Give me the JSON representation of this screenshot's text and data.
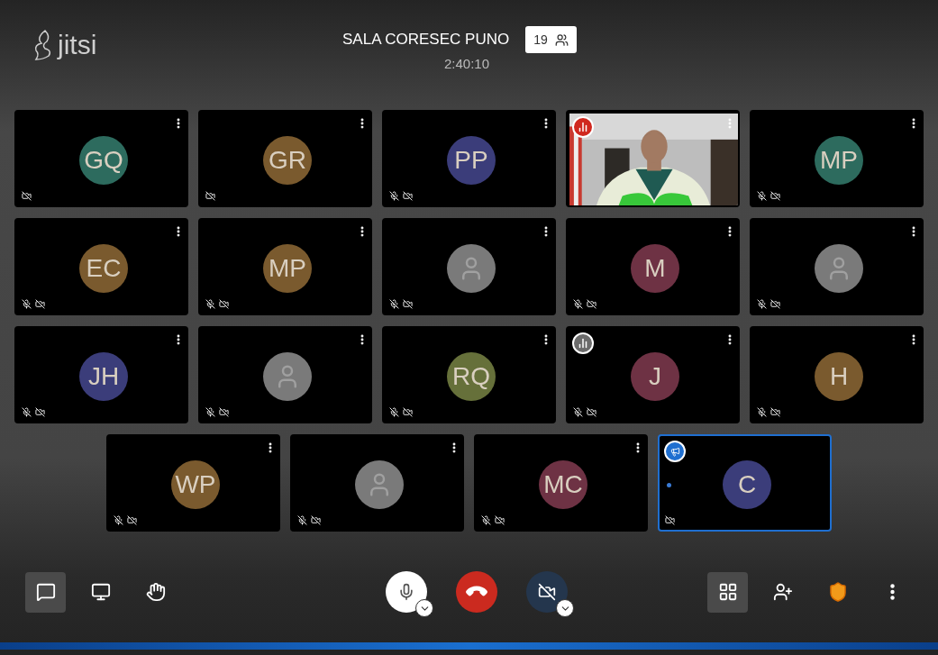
{
  "header": {
    "logo": "jitsi",
    "title": "SALA CORESEC PUNO",
    "participant_count": "19",
    "timer": "2:40:10"
  },
  "rows": [
    [
      {
        "kind": "avatar",
        "initials": "GQ",
        "color": "#2d6b5e",
        "mic_muted": false,
        "cam_muted": true,
        "menu": true,
        "selected": false
      },
      {
        "kind": "avatar",
        "initials": "GR",
        "color": "#7a5a2e",
        "mic_muted": false,
        "cam_muted": true,
        "menu": true,
        "selected": false
      },
      {
        "kind": "avatar",
        "initials": "PP",
        "color": "#3b3d7a",
        "mic_muted": true,
        "cam_muted": true,
        "menu": true,
        "selected": false
      },
      {
        "kind": "video",
        "badge": {
          "kind": "signal-poor"
        },
        "mic_muted": false,
        "cam_muted": false,
        "menu": true,
        "selected": false
      },
      {
        "kind": "avatar",
        "initials": "MP",
        "color": "#2d6b5e",
        "mic_muted": true,
        "cam_muted": true,
        "menu": true,
        "selected": false
      }
    ],
    [
      {
        "kind": "avatar",
        "initials": "EC",
        "color": "#7a5a2e",
        "mic_muted": true,
        "cam_muted": true,
        "menu": true,
        "selected": false
      },
      {
        "kind": "avatar",
        "initials": "MP",
        "color": "#7a5a2e",
        "mic_muted": true,
        "cam_muted": true,
        "menu": true,
        "selected": false
      },
      {
        "kind": "placeholder",
        "mic_muted": true,
        "cam_muted": true,
        "menu": true,
        "selected": false
      },
      {
        "kind": "avatar",
        "initials": "M",
        "color": "#6e3244",
        "mic_muted": true,
        "cam_muted": true,
        "menu": true,
        "selected": false
      },
      {
        "kind": "placeholder",
        "mic_muted": true,
        "cam_muted": true,
        "menu": true,
        "selected": false
      }
    ],
    [
      {
        "kind": "avatar",
        "initials": "JH",
        "color": "#3b3d7a",
        "mic_muted": true,
        "cam_muted": true,
        "menu": true,
        "selected": false
      },
      {
        "kind": "placeholder",
        "mic_muted": true,
        "cam_muted": true,
        "menu": true,
        "selected": false
      },
      {
        "kind": "avatar",
        "initials": "RQ",
        "color": "#66703a",
        "mic_muted": true,
        "cam_muted": true,
        "menu": true,
        "selected": false
      },
      {
        "kind": "avatar",
        "initials": "J",
        "color": "#6e3244",
        "badge": {
          "kind": "signal-inactive"
        },
        "mic_muted": true,
        "cam_muted": true,
        "menu": true,
        "selected": false
      },
      {
        "kind": "avatar",
        "initials": "H",
        "color": "#7a5a2e",
        "mic_muted": true,
        "cam_muted": true,
        "menu": true,
        "selected": false
      }
    ],
    [
      {
        "kind": "avatar",
        "initials": "WP",
        "color": "#7a5a2e",
        "mic_muted": true,
        "cam_muted": true,
        "menu": true,
        "selected": false
      },
      {
        "kind": "placeholder",
        "mic_muted": true,
        "cam_muted": true,
        "menu": true,
        "selected": false
      },
      {
        "kind": "avatar",
        "initials": "MC",
        "color": "#6e3244",
        "mic_muted": true,
        "cam_muted": true,
        "menu": true,
        "selected": false
      },
      {
        "kind": "avatar",
        "initials": "C",
        "color": "#3b3d7a",
        "badge": {
          "kind": "moderator"
        },
        "mic_muted": false,
        "cam_muted": true,
        "menu": false,
        "selected": true
      }
    ]
  ],
  "toolbar": {
    "left": [
      {
        "kind": "chat",
        "selected": true
      },
      {
        "kind": "screen-share",
        "selected": false
      },
      {
        "kind": "raise-hand",
        "selected": false
      }
    ],
    "center": [
      {
        "kind": "microphone",
        "on": true
      },
      {
        "kind": "hangup"
      },
      {
        "kind": "camera",
        "on": false
      }
    ],
    "right": [
      {
        "kind": "tile-view",
        "selected": true
      },
      {
        "kind": "invite",
        "selected": false
      },
      {
        "kind": "security",
        "selected": false
      },
      {
        "kind": "more",
        "selected": false
      }
    ]
  }
}
